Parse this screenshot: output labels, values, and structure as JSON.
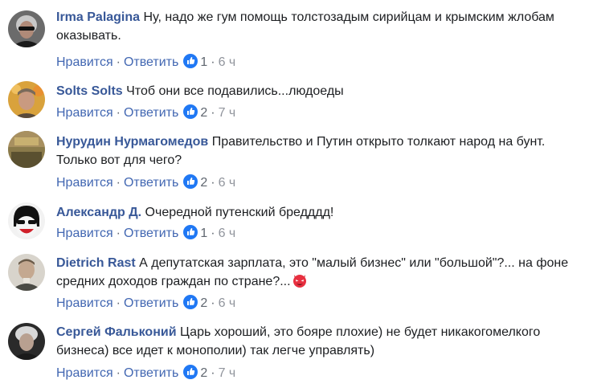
{
  "comments": [
    {
      "author": "Irma Palagina",
      "text": "Ну, надо же гум помощь толстозадым сирийцам и крымским жлобам оказывать.",
      "like_label": "Нравится",
      "reply_label": "Ответить",
      "reactions": "1",
      "time": "6 ч"
    },
    {
      "author": "Solts Solts",
      "text": "Чтоб они все подавились...людоеды",
      "like_label": "Нравится",
      "reply_label": "Ответить",
      "reactions": "2",
      "time": "7 ч"
    },
    {
      "author": "Нурудин Нурмагомедов",
      "text": "Правительство и Путин открыто толкают народ на бунт. Только вот для чего?",
      "like_label": "Нравится",
      "reply_label": "Ответить",
      "reactions": "2",
      "time": "6 ч"
    },
    {
      "author": "Александр Д.",
      "text": "Очередной путенский бредддд!",
      "like_label": "Нравится",
      "reply_label": "Ответить",
      "reactions": "1",
      "time": "6 ч"
    },
    {
      "author": "Dietrich Rast",
      "text": "А депутатская зарплата, это \"малый бизнес\" или \"большой\"?... на фоне средних доходов граждан по стране?...",
      "emoji": "devil-emoji",
      "like_label": "Нравится",
      "reply_label": "Ответить",
      "reactions": "2",
      "time": "6 ч"
    },
    {
      "author": "Сергей Фальконий",
      "text": "Царь хороший, это бояре плохие) не будет никакогомелкого бизнеса) все идет к монополии) так легче управлять)",
      "like_label": "Нравится",
      "reply_label": "Ответить",
      "reactions": "2",
      "time": "7 ч"
    }
  ],
  "separator": "·",
  "colors": {
    "author": "#385898",
    "link": "#4267b2",
    "meta": "#606770",
    "like_badge": "#2078f4"
  },
  "icons": {
    "like": "thumbs-up-icon"
  }
}
